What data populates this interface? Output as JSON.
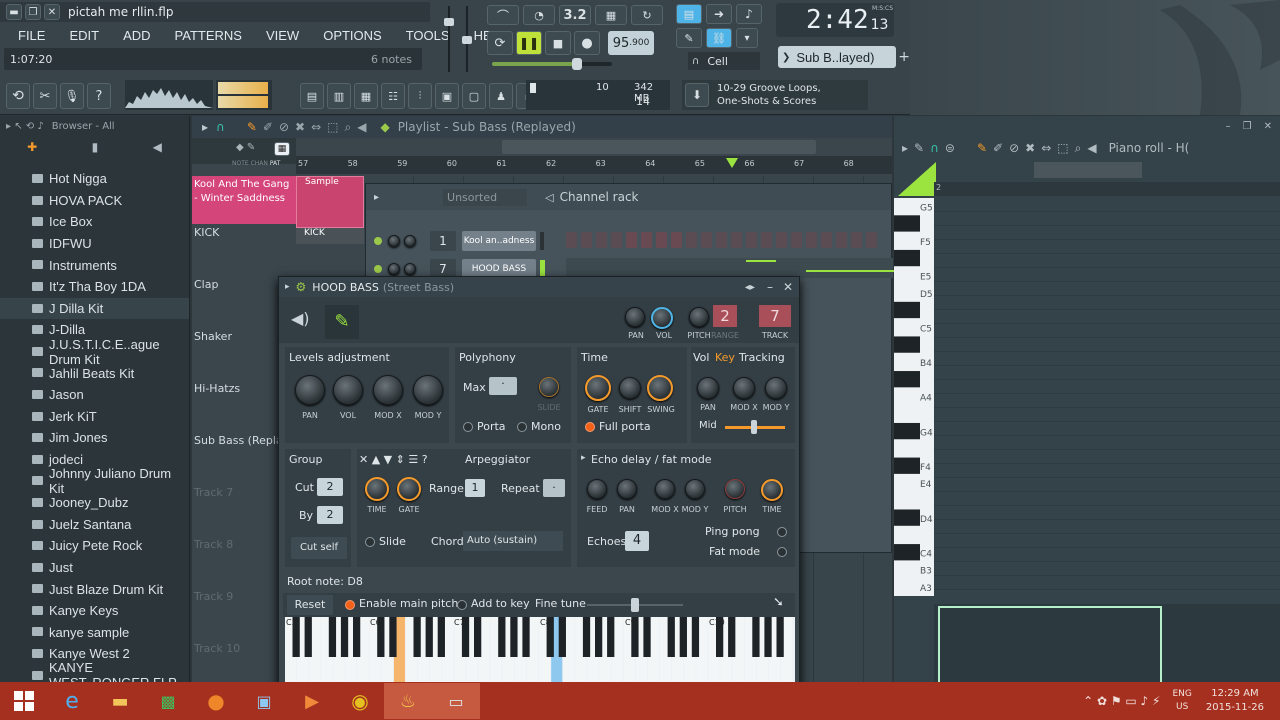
{
  "window": {
    "title": "pictah me rllin.flp"
  },
  "menu": [
    "FILE",
    "EDIT",
    "ADD",
    "PATTERNS",
    "VIEW",
    "OPTIONS",
    "TOOLS",
    "HELP"
  ],
  "hint_time": "1:07:20",
  "notes_count": "6 notes",
  "transport": {
    "tempo": "95",
    "tempo_frac": ".900",
    "time": "2:42",
    "time_sub": "13",
    "time_unit": "M:S:CS",
    "pattern_mode": "3.2"
  },
  "mixer_target": "Sub B..layed)",
  "snap": "Cell",
  "cpu": {
    "val": "10",
    "mem": "342 MB",
    "poly": "14"
  },
  "news": {
    "line1": "10-29  Groove Loops,",
    "line2": "One-Shots & Scores"
  },
  "browser": {
    "header": "Browser - All",
    "items": [
      "Hot Nigga",
      "HOVA PACK",
      "Ice Box",
      "IDFWU",
      "Instruments",
      "It'z Tha Boy 1DA",
      "J Dilla Kit",
      "J-Dilla",
      "J.U.S.T.I.C.E..ague Drum Kit",
      "Jahlil Beats Kit",
      "Jason",
      "Jerk KiT",
      "Jim Jones",
      "jodeci",
      "Johnny Juliano Drum  Kit",
      "Jooney_Dubz",
      "Juelz Santana",
      "Juicy Pete Rock",
      "Just",
      "Just Blaze Drum Kit",
      "Kanye Keys",
      "kanye sample",
      "Kanye West 2",
      "KANYE WEST..RONGER FLP"
    ]
  },
  "playlist": {
    "title": "Playlist - Sub Bass (Replayed)",
    "bars": [
      "57",
      "58",
      "59",
      "60",
      "61",
      "62",
      "63",
      "64",
      "65",
      "66",
      "67",
      "68"
    ],
    "tracks": [
      "Kool And The Gang - Winter Saddness",
      "KICK",
      "Clap",
      "Shaker",
      "Hi-Hatzs",
      "Sub Bass (Replay",
      "Track 7",
      "Track 8",
      "Track 9",
      "Track 10"
    ],
    "clip_sample": "Sample",
    "clip_kick": "KICK",
    "col_heads": [
      "NOTE",
      "CHAN",
      "PAT"
    ]
  },
  "channel_rack": {
    "title": "Channel rack",
    "filter": "Unsorted",
    "channels": [
      {
        "num": "1",
        "name": "Kool an..adness"
      },
      {
        "num": "7",
        "name": "HOOD BASS"
      }
    ]
  },
  "channel_settings": {
    "title": "HOOD BASS",
    "subtitle": "(Street Bass)",
    "pitch_range": "2",
    "track": "7",
    "top_knobs": [
      "PAN",
      "VOL",
      "PITCH",
      "RANGE",
      "TRACK"
    ],
    "levels_title": "Levels adjustment",
    "levels_knobs": [
      "PAN",
      "VOL",
      "MOD X",
      "MOD Y"
    ],
    "polyphony_title": "Polyphony",
    "max_label": "Max",
    "slide_label": "SLIDE",
    "porta": "Porta",
    "mono": "Mono",
    "time_title": "Time",
    "time_knobs": [
      "GATE",
      "SHIFT",
      "SWING"
    ],
    "full_porta": "Full porta",
    "tracking_vol": "Vol",
    "tracking_key": "Key",
    "tracking_title": "Tracking",
    "tracking_knobs": [
      "PAN",
      "MOD X",
      "MOD Y"
    ],
    "mid_label": "Mid",
    "group_title": "Group",
    "cut_label": "Cut",
    "cut_val": "2",
    "by_label": "By",
    "by_val": "2",
    "cut_self": "Cut self",
    "arp_title": "Arpeggiator",
    "arp_knobs": [
      "TIME",
      "GATE"
    ],
    "range_label": "Range",
    "range_val": "1",
    "repeat_label": "Repeat",
    "slide": "Slide",
    "chord_label": "Chord",
    "chord_val": "Auto (sustain)",
    "echo_title": "Echo delay / fat mode",
    "echo_knobs": [
      "FEED",
      "PAN",
      "MOD X",
      "MOD Y",
      "PITCH",
      "TIME"
    ],
    "echoes_label": "Echoes",
    "echoes_val": "4",
    "ping_pong": "Ping pong",
    "fat_mode": "Fat mode",
    "root_note": "Root note: D8",
    "reset": "Reset",
    "enable_main_pitch": "Enable main pitch",
    "add_to_key": "Add to key",
    "fine_tune": "Fine tune",
    "octaves": [
      "C5",
      "C6",
      "C7",
      "C8",
      "C9",
      "C10"
    ]
  },
  "piano_roll": {
    "title": "Piano roll - H(",
    "bar": "2",
    "keys": [
      "G5",
      "F5",
      "E5",
      "D5",
      "C5",
      "B4",
      "A4",
      "G4",
      "F4",
      "E4",
      "D4",
      "C4",
      "B3",
      "A3"
    ]
  },
  "taskbar": {
    "lang1": "ENG",
    "lang2": "US",
    "clock": "12:29 AM",
    "date": "2015-11-26"
  }
}
